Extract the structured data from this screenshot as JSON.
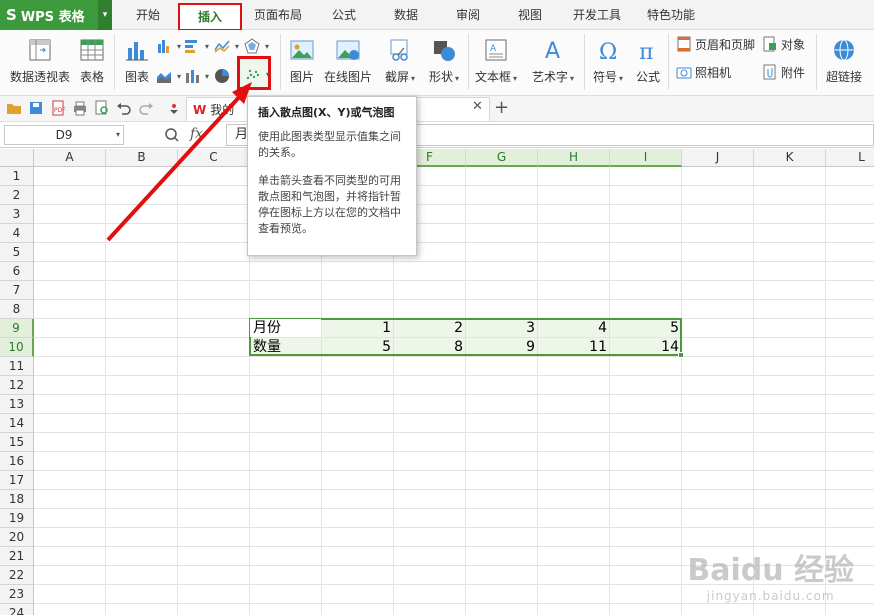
{
  "app": {
    "name": "WPS 表格",
    "logo": "S"
  },
  "menu_tabs": [
    {
      "label": "开始"
    },
    {
      "label": "插入"
    },
    {
      "label": "页面布局"
    },
    {
      "label": "公式"
    },
    {
      "label": "数据"
    },
    {
      "label": "审阅"
    },
    {
      "label": "视图"
    },
    {
      "label": "开发工具"
    },
    {
      "label": "特色功能"
    }
  ],
  "active_tab": "插入",
  "ribbon": {
    "pivot": "数据透视表",
    "table": "表格",
    "chart": "图表",
    "picture": "图片",
    "online_picture": "在线图片",
    "screenshot": "截屏",
    "shapes": "形状",
    "textbox": "文本框",
    "wordart": "艺术字",
    "symbol": "符号",
    "formula": "公式",
    "header_footer": "页眉和页脚",
    "object": "对象",
    "camera": "照相机",
    "attachment": "附件",
    "hyperlink": "超链接"
  },
  "doc_tab": {
    "label": "我的"
  },
  "formula_bar": {
    "cell_ref": "D9",
    "fx": "fx",
    "value": "月"
  },
  "tooltip": {
    "title": "插入散点图(X、Y)或气泡图",
    "para1": "使用此图表类型显示值集之间的关系。",
    "para2": "单击箭头查看不同类型的可用散点图和气泡图，并将指针暂停在图标上方以在您的文档中查看预览。"
  },
  "columns": [
    "A",
    "B",
    "C",
    "D",
    "E",
    "F",
    "G",
    "H",
    "I",
    "J",
    "K",
    "L"
  ],
  "rows": [
    "1",
    "2",
    "3",
    "4",
    "5",
    "6",
    "7",
    "8",
    "9",
    "10",
    "11",
    "12",
    "13",
    "14",
    "15",
    "16",
    "17",
    "18",
    "19",
    "20",
    "21",
    "22",
    "23",
    "24"
  ],
  "sheet": {
    "row9": {
      "label": "月份",
      "values": [
        "1",
        "2",
        "3",
        "4",
        "5"
      ]
    },
    "row10": {
      "label": "数量",
      "values": [
        "5",
        "8",
        "9",
        "11",
        "14"
      ]
    }
  },
  "watermark": {
    "main": "Baidu 经验",
    "sub": "jingyan.baidu.com"
  },
  "colors": {
    "accent_green": "#3c9a3c",
    "highlight_red": "#e01010",
    "selection_green": "#4e9a3a"
  }
}
